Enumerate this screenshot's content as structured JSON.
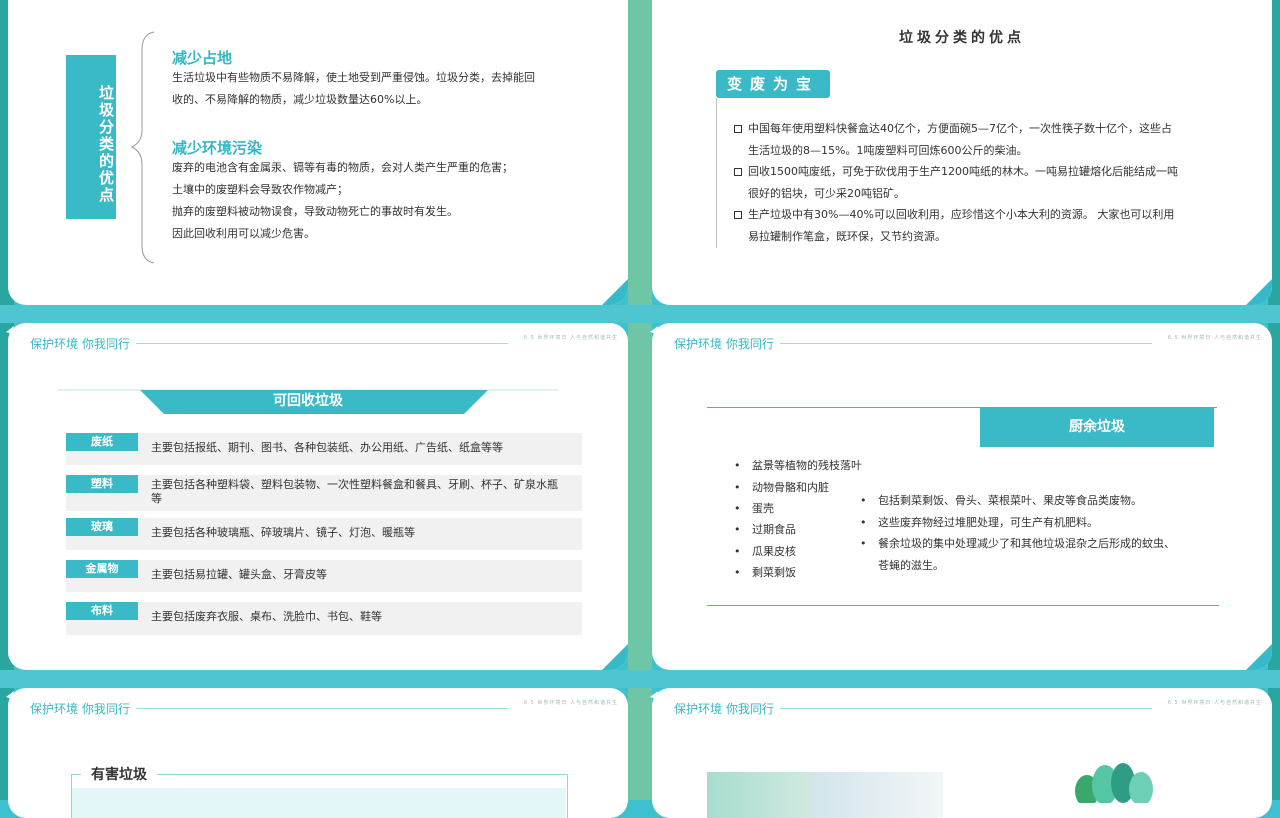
{
  "header": {
    "left_text": "保护环境  你我同行",
    "right_text": "6.5  世界环境日  人与自然和谐共生"
  },
  "slide1": {
    "vertical_tag": "垃圾分类的优点",
    "section1_title": "减少占地",
    "section1_lines": [
      "生活垃圾中有些物质不易降解，使土地受到严重侵蚀。垃圾分类，去掉能回",
      "收的、不易降解的物质，减少垃圾数量达60%以上。"
    ],
    "section2_title": "减少环境污染",
    "section2_lines": [
      "废弃的电池含有金属汞、镉等有毒的物质，会对人类产生严重的危害；",
      "土壤中的废塑料会导致农作物减产；",
      "抛弃的废塑料被动物误食，导致动物死亡的事故时有发生。",
      "因此回收利用可以减少危害。"
    ]
  },
  "slide2": {
    "title": "垃圾分类的优点",
    "badge": "变废为宝",
    "items": [
      {
        "line1": "中国每年使用塑料快餐盒达40亿个，方便面碗5—7亿个，一次性筷子数十亿个，这些占",
        "line2": "生活垃圾的8—15%。1吨废塑料可回炼600公斤的柴油。"
      },
      {
        "line1": "回收1500吨废纸，可免于砍伐用于生产1200吨纸的林木。一吨易拉罐熔化后能结成一吨",
        "line2": "很好的铝块，可少采20吨铝矿。"
      },
      {
        "line1": "生产垃圾中有30%—40%可以回收利用，应珍惜这个小本大利的资源。 大家也可以利用",
        "line2": "易拉罐制作笔盒，既环保，又节约资源。"
      }
    ]
  },
  "slide3": {
    "banner": "可回收垃圾",
    "rows": [
      {
        "label": "废纸",
        "text": "主要包括报纸、期刊、图书、各种包装纸、办公用纸、广告纸、纸盒等等"
      },
      {
        "label": "塑料",
        "text": "主要包括各种塑料袋、塑料包装物、一次性塑料餐盒和餐具、牙刷、杯子、矿泉水瓶等"
      },
      {
        "label": "玻璃",
        "text": "主要包括各种玻璃瓶、碎玻璃片、镜子、灯泡、暖瓶等"
      },
      {
        "label": "金属物",
        "text": "主要包括易拉罐、罐头盒、牙膏皮等"
      },
      {
        "label": "布料",
        "text": "主要包括废弃衣服、桌布、洗脸巾、书包、鞋等"
      }
    ]
  },
  "slide4": {
    "badge": "厨余垃圾",
    "left_list": [
      "盆景等植物的残枝落叶",
      "动物骨骼和内脏",
      "蛋壳",
      "过期食品",
      "瓜果皮核",
      "剩菜剩饭"
    ],
    "right_list": [
      "包括剩菜剩饭、骨头、菜根菜叶、果皮等食品类废物。",
      "这些废弃物经过堆肥处理，可生产有机肥料。",
      "餐余垃圾的集中处理减少了和其他垃圾混杂之后形成的蚊虫、"
    ],
    "right_list_cont": "苍蝇的滋生。",
    "bullet": "•"
  },
  "slide5": {
    "title": "有害垃圾"
  }
}
